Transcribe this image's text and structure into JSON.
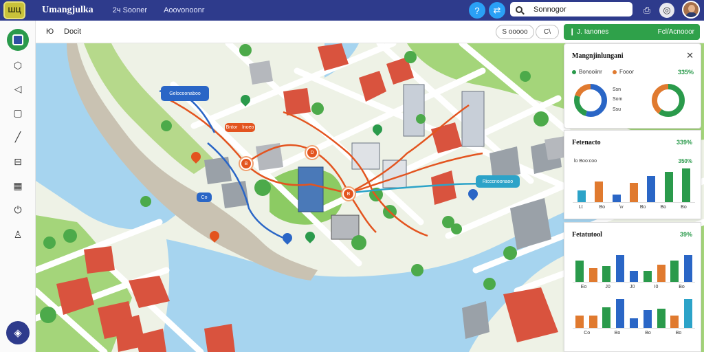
{
  "app": {
    "logo_text": "ШЦ",
    "title": "Umangjulka"
  },
  "nav": [
    "2ч Sooner",
    "Aoovonoonr"
  ],
  "search": {
    "value": "Sonnogor"
  },
  "toolbar": {
    "crumb_left": "Ю",
    "crumb_title": "Docit",
    "btn_one": "S ooooo",
    "btn_two": "C\\",
    "green_button": {
      "left": "❙ J. Ianones",
      "right": "Fcl/Acnooor"
    }
  },
  "map": {
    "labels": [
      {
        "text": "Gelocoonaboo",
        "color": "#2a66c6"
      },
      {
        "text": "Bntor lnoeo",
        "color": "#e3541f"
      },
      {
        "text": "Ricccnoonaoo",
        "color": "#2ca3c8"
      },
      {
        "text": "Co",
        "color": "#2a66c6"
      }
    ],
    "nodes": [
      "B",
      "D",
      "B",
      "B"
    ],
    "colors": {
      "water": "#a6d4ef",
      "park": "#a4d57a",
      "road": "#ffffff",
      "route_orange": "#e3541f",
      "route_blue": "#2a66c6",
      "route_teal": "#2ca3c8",
      "roof": "#d9533e",
      "building": "#f1eee8"
    }
  },
  "panel1": {
    "title": "Mangnjinlungani",
    "legend": [
      {
        "label": "Bonooiinr",
        "color": "#2a9a4b"
      },
      {
        "label": "Fooor",
        "color": "#e07a2f"
      }
    ],
    "pct": "335%",
    "donut_labels": [
      "Ssn",
      "Som",
      "Ssu"
    ],
    "donuts": [
      {
        "segments": [
          {
            "value": 55,
            "color": "#2a66c6"
          },
          {
            "value": 25,
            "color": "#2a9a4b"
          },
          {
            "value": 20,
            "color": "#e07a2f"
          }
        ]
      },
      {
        "segments": [
          {
            "value": 60,
            "color": "#2a9a4b"
          },
          {
            "value": 40,
            "color": "#e07a2f"
          }
        ]
      }
    ]
  },
  "panel2": {
    "title": "Fetenacto",
    "pct": "339%",
    "sub_label": "lo Boo:coo",
    "sub_pct": "350%",
    "ticks": [
      "Lt",
      "Bo",
      "\\v",
      "Bo",
      "Bo",
      "Bo"
    ],
    "bars": [
      {
        "value": 18,
        "color": "#2ca3c8"
      },
      {
        "value": 32,
        "color": "#e07a2f"
      },
      {
        "value": 12,
        "color": "#2a66c6"
      },
      {
        "value": 30,
        "color": "#e07a2f"
      },
      {
        "value": 40,
        "color": "#2a66c6"
      },
      {
        "value": 47,
        "color": "#2a9a4b"
      },
      {
        "value": 52,
        "color": "#2a9a4b"
      }
    ]
  },
  "panel3": {
    "title": "Fetatutool",
    "pct": "39%",
    "ticks_a": [
      "Eo",
      "J0",
      "J0",
      "I0",
      "Bo"
    ],
    "ticks_b": [
      "Co",
      "Bo",
      "Bo",
      "Bo"
    ],
    "bars_a": [
      {
        "value": 30,
        "color": "#2a9a4b"
      },
      {
        "value": 20,
        "color": "#e07a2f"
      },
      {
        "value": 22,
        "color": "#2a9a4b"
      },
      {
        "value": 38,
        "color": "#2a66c6"
      },
      {
        "value": 16,
        "color": "#2a66c6"
      },
      {
        "value": 16,
        "color": "#2a9a4b"
      },
      {
        "value": 24,
        "color": "#e07a2f"
      },
      {
        "value": 30,
        "color": "#2a9a4b"
      },
      {
        "value": 38,
        "color": "#2a66c6"
      }
    ],
    "bars_b": [
      {
        "value": 18,
        "color": "#e07a2f"
      },
      {
        "value": 18,
        "color": "#e07a2f"
      },
      {
        "value": 30,
        "color": "#2a9a4b"
      },
      {
        "value": 42,
        "color": "#2a66c6"
      },
      {
        "value": 14,
        "color": "#2a66c6"
      },
      {
        "value": 26,
        "color": "#2a66c6"
      },
      {
        "value": 28,
        "color": "#2a9a4b"
      },
      {
        "value": 18,
        "color": "#e07a2f"
      },
      {
        "value": 42,
        "color": "#2ca3c8"
      }
    ]
  }
}
